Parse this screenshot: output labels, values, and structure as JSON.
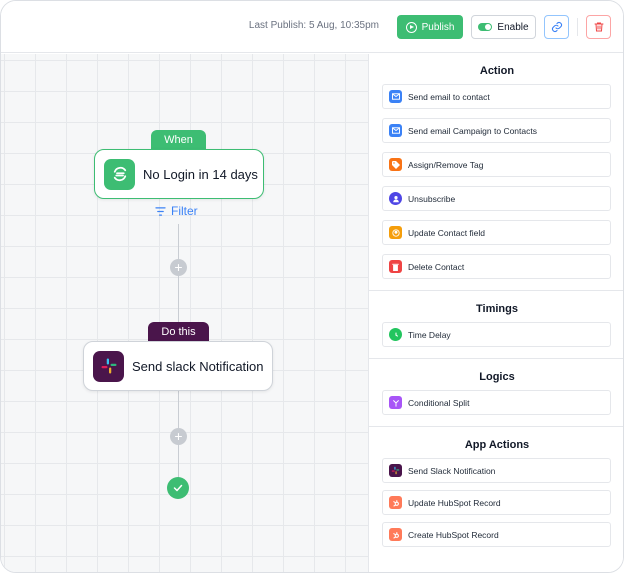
{
  "header": {
    "last_publish": "Last Publish: 5 Aug, 10:35pm",
    "publish_label": "Publish",
    "enable_label": "Enable"
  },
  "canvas": {
    "trigger_chip": "When",
    "trigger_title": "No Login in 14 days",
    "filter_label": "Filter",
    "action_chip": "Do this",
    "action_title": "Send slack Notification"
  },
  "panel": {
    "action": {
      "title": "Action",
      "items": [
        {
          "label": "Send email to contact",
          "icon": "mail-icon",
          "color": "#3b82f6"
        },
        {
          "label": "Send email Campaign to Contacts",
          "icon": "mail-icon",
          "color": "#3b82f6"
        },
        {
          "label": "Assign/Remove Tag",
          "icon": "tag-icon",
          "color": "#f97316"
        },
        {
          "label": "Unsubscribe",
          "icon": "user-icon",
          "color": "#4f46e5"
        },
        {
          "label": "Update Contact field",
          "icon": "contact-icon",
          "color": "#f59e0b"
        },
        {
          "label": "Delete Contact",
          "icon": "trash-icon",
          "color": "#ef4444"
        }
      ]
    },
    "timings": {
      "title": "Timings",
      "items": [
        {
          "label": "Time Delay",
          "icon": "clock-icon",
          "color": "#22c55e"
        }
      ]
    },
    "logics": {
      "title": "Logics",
      "items": [
        {
          "label": "Conditional Split",
          "icon": "split-icon",
          "color": "#a855f7"
        }
      ]
    },
    "app_actions": {
      "title": "App Actions",
      "items": [
        {
          "label": "Send Slack Notification",
          "icon": "slack-icon",
          "color": "#4a154b"
        },
        {
          "label": "Update HubSpot Record",
          "icon": "hubspot-icon",
          "color": "#ff7a59"
        },
        {
          "label": "Create HubSpot Record",
          "icon": "hubspot-icon",
          "color": "#ff7a59"
        }
      ]
    }
  }
}
